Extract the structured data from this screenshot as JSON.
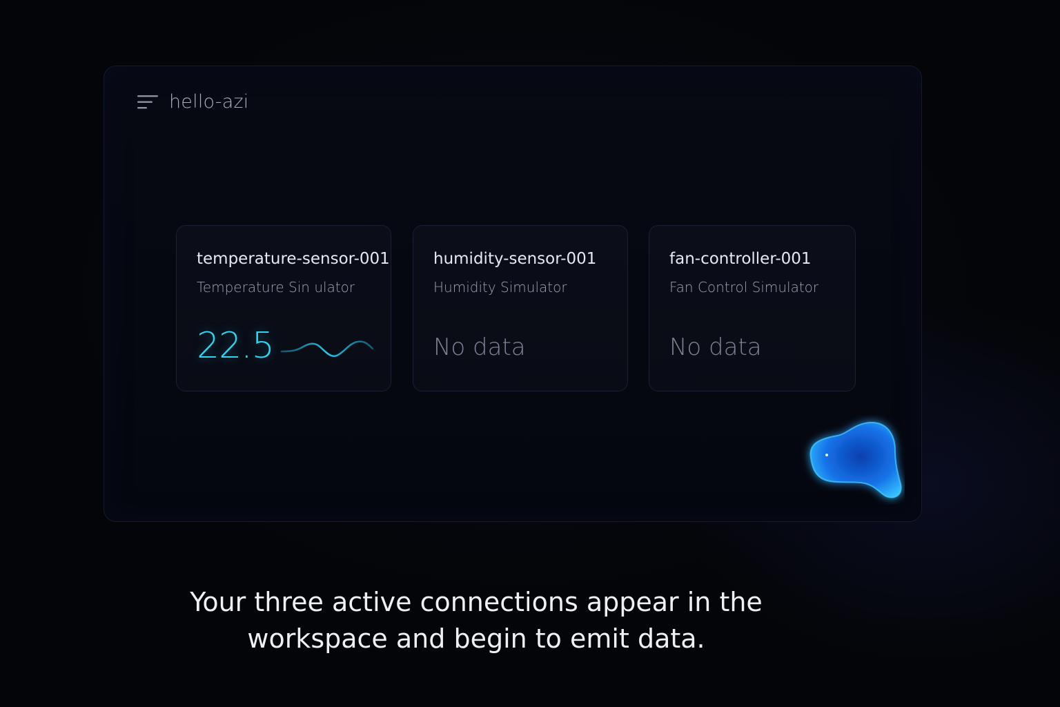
{
  "workspace": {
    "title": "hello-azi",
    "menu_icon": "menu-lines-icon"
  },
  "devices": [
    {
      "name": "temperature-sensor-001",
      "subtitle": "Temperature Sin ulator",
      "value": "22.5",
      "sparkline_icon": "wave-sparkline"
    },
    {
      "name": "humidity-sensor-001",
      "subtitle": "Humidity Simulator",
      "value": "No data"
    },
    {
      "name": "fan-controller-001",
      "subtitle": "Fan Control Simulator",
      "value": "No data"
    }
  ],
  "assistant": {
    "icon": "glowing-blob-icon",
    "color": "#1f8cff"
  },
  "caption": {
    "line1": "Your three active connections appear in the",
    "line2": "workspace and begin to emit data."
  },
  "colors": {
    "background": "#040508",
    "accent": "#2fd6f0",
    "text_primary": "#e6e9f0",
    "text_muted": "#7d8394"
  }
}
